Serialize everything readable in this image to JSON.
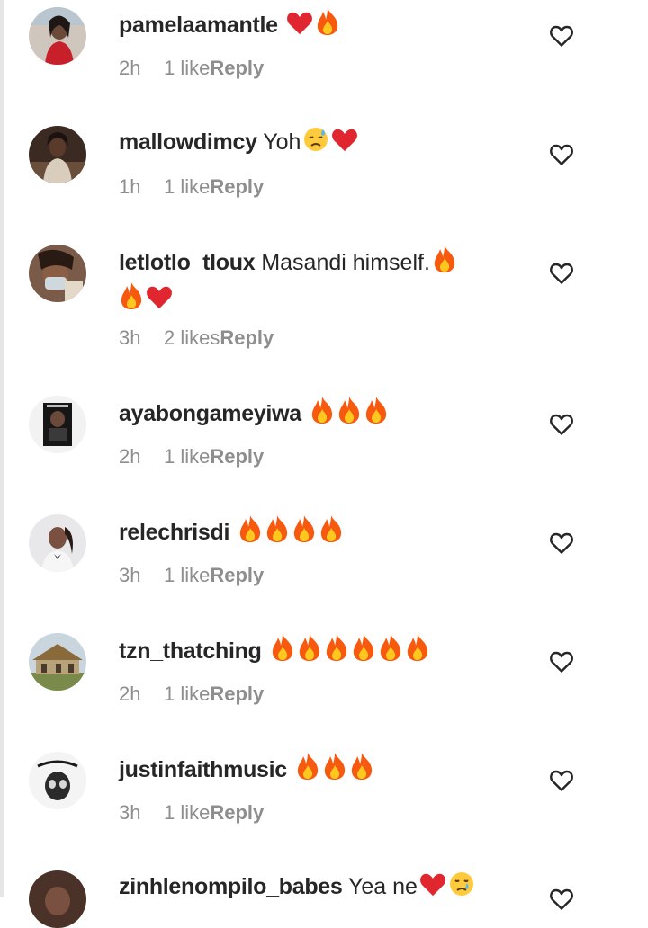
{
  "icons": {
    "like": "heart-outline-icon",
    "fire": "fire-emoji",
    "red_heart": "red-heart-emoji",
    "sad_sweat": "sad-but-relieved-emoji",
    "crying": "crying-emoji"
  },
  "colors": {
    "text": "#262626",
    "secondary": "#8e8e8e",
    "heart_emoji": "#e0262e",
    "fire_outer": "#f7590f",
    "fire_inner": "#ffc81f"
  },
  "comments": [
    {
      "username": "pamelaamantle",
      "text": "",
      "emoji": [
        "red-heart",
        "fire"
      ],
      "time": "2h",
      "likes": "1 like",
      "reply": "Reply"
    },
    {
      "username": "mallowdimcy",
      "text": "Yoh",
      "emoji": [
        "sad-but-relieved",
        "red-heart"
      ],
      "time": "1h",
      "likes": "1 like",
      "reply": "Reply"
    },
    {
      "username": "letlotlo_tloux",
      "text": "Masandi himself.",
      "emoji": [
        "fire",
        "fire",
        "red-heart"
      ],
      "time": "3h",
      "likes": "2 likes",
      "reply": "Reply"
    },
    {
      "username": "ayabongameyiwa",
      "text": "",
      "emoji": [
        "fire",
        "fire",
        "fire"
      ],
      "time": "2h",
      "likes": "1 like",
      "reply": "Reply"
    },
    {
      "username": "relechrisdi",
      "text": "",
      "emoji": [
        "fire",
        "fire",
        "fire",
        "fire"
      ],
      "time": "3h",
      "likes": "1 like",
      "reply": "Reply"
    },
    {
      "username": "tzn_thatching",
      "text": "",
      "emoji": [
        "fire",
        "fire",
        "fire",
        "fire",
        "fire",
        "fire"
      ],
      "time": "2h",
      "likes": "1 like",
      "reply": "Reply"
    },
    {
      "username": "justinfaithmusic",
      "text": "",
      "emoji": [
        "fire",
        "fire",
        "fire"
      ],
      "time": "3h",
      "likes": "1 like",
      "reply": "Reply"
    },
    {
      "username": "zinhlenompilo_babes",
      "text": "Yea ne",
      "emoji": [
        "red-heart",
        "crying"
      ],
      "time": "",
      "likes": "",
      "reply": ""
    }
  ]
}
